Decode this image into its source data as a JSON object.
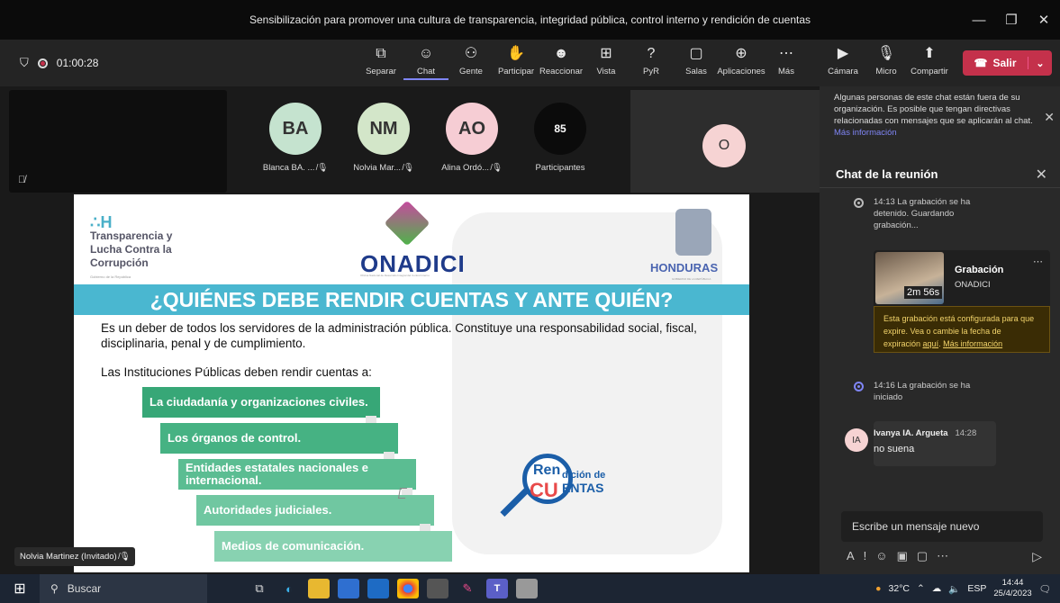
{
  "window": {
    "title": "Sensibilización para promover una cultura de transparencia, integridad pública, control interno y rendición de cuentas"
  },
  "toolbar": {
    "timer": "01:00:28",
    "tools": [
      {
        "icon": "⧉",
        "label": "Separar",
        "name": "separar"
      },
      {
        "icon": "☺",
        "label": "Chat",
        "name": "chat"
      },
      {
        "icon": "⚇",
        "label": "Gente",
        "name": "gente"
      },
      {
        "icon": "✋",
        "label": "Participar",
        "name": "participar"
      },
      {
        "icon": "☻",
        "label": "Reaccionar",
        "name": "reaccionar"
      },
      {
        "icon": "⊞",
        "label": "Vista",
        "name": "vista"
      },
      {
        "icon": "?",
        "label": "PyR",
        "name": "pyr"
      },
      {
        "icon": "▢",
        "label": "Salas",
        "name": "salas"
      },
      {
        "icon": "⊕",
        "label": "Aplicaciones",
        "name": "aplicaciones"
      },
      {
        "icon": "⋯",
        "label": "Más",
        "name": "mas"
      }
    ],
    "devices": [
      {
        "icon": "▶",
        "label": "Cámara",
        "name": "camara"
      },
      {
        "icon": "🎙",
        "label": "Micro",
        "name": "micro"
      },
      {
        "icon": "⬆",
        "label": "Compartir",
        "name": "compartir"
      }
    ],
    "leave": "Salir"
  },
  "participants": [
    {
      "initials": "BA",
      "name": "Blanca BA. ...",
      "color": "#c5e3cf"
    },
    {
      "initials": "NM",
      "name": "Nolvia Mar...",
      "color": "#d3e6c9"
    },
    {
      "initials": "AO",
      "name": "Alina Ordó...",
      "color": "#f6cdd4"
    }
  ],
  "participants_count": {
    "count": "85",
    "label": "Participantes"
  },
  "right_tile": {
    "initials": "O"
  },
  "slide": {
    "tlc_line1": "Transparencia y",
    "tlc_line2": "Lucha Contra la",
    "tlc_line3": "Corrupción",
    "tlc_sub": "Gobierno de la República",
    "onadici": "ONADICI",
    "onadici_sub": "Oficina Nacional de Desarrollo Integral del Control Interno",
    "honduras": "HONDURAS",
    "honduras_sub": "GOBIERNO DE LA REPÚBLICA",
    "title": "¿QUIÉNES DEBE RENDIR CUENTAS Y ANTE QUIÉN?",
    "paragraph": "Es un deber de todos los servidores de la administración pública.  Constituye una responsabilidad social, fiscal, disciplinaria, penal y de cumplimiento.",
    "list_intro": "Las Instituciones Públicas deben rendir cuentas a:",
    "steps": [
      "La ciudadanía y organizaciones civiles.",
      "Los órganos de control.",
      "Entidades estatales nacionales e internacional.",
      "Autoridades judiciales.",
      "Medios de comunicación."
    ],
    "rendicion_a": "Ren",
    "rendicion_b": "dición de",
    "rendicion_c": "CU",
    "rendicion_d": "ENTAS"
  },
  "name_badge": "Nolvia Martinez (Invitado)",
  "chat": {
    "notice": "Algunas personas de este chat están fuera de su organización. Es posible que tengan directivas relacionadas con mensajes que se aplicarán al chat.",
    "notice_link": "Más información",
    "title": "Chat de la reunión",
    "sys1": "14:13  La grabación se ha detenido. Guardando grabación...",
    "recording": {
      "title": "Grabación",
      "org": "ONADICI",
      "duration": "2m 56s"
    },
    "warning": "Esta grabación está configurada para que expire. Vea o cambie la fecha de expiración",
    "warning_link1": "aquí",
    "warning_link2": "Más información",
    "sys2": "14:16  La grabación se ha iniciado",
    "message": {
      "initials": "IA",
      "author": "Ivanya IA. Argueta",
      "time": "14:28",
      "text": "no suena"
    },
    "compose_placeholder": "Escribe un mensaje nuevo"
  },
  "taskbar": {
    "search": "Buscar",
    "weather": "32°C",
    "lang": "ESP",
    "time": "14:44",
    "date": "25/4/2023"
  },
  "colors": {
    "accent": "#7f85f5",
    "leave": "#c4314b",
    "banner": "#4ab7d0",
    "step": "#47b584"
  }
}
